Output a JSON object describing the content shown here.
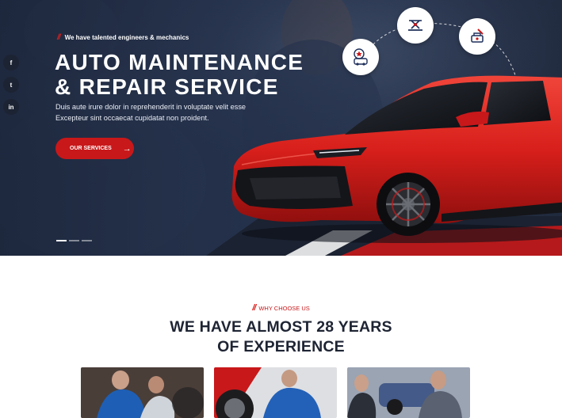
{
  "hero": {
    "tagline": "We have talented engineers & mechanics",
    "title_line1": "AUTO MAINTENANCE",
    "title_line2": "& REPAIR SERVICE",
    "description_line1": "Duis aute irure dolor in reprehenderit in voluptate velit esse",
    "description_line2": "Excepteur sint occaecat cupidatat non proident.",
    "cta_label": "OUR SERVICES",
    "slide_indicators": 3,
    "active_slide": 1,
    "service_icons": [
      "car-wash-icon",
      "car-jack-icon",
      "engine-tools-icon"
    ]
  },
  "social": {
    "facebook": "f",
    "twitter": "t",
    "linkedin": "in"
  },
  "why": {
    "eyebrow": "WHY CHOOSE US",
    "headline_line1": "WE HAVE ALMOST 28 YEARS",
    "headline_line2": "OF EXPERIENCE"
  },
  "colors": {
    "accent": "#c8181a",
    "hero_bg": "#2b3853",
    "heading": "#1e2433"
  }
}
